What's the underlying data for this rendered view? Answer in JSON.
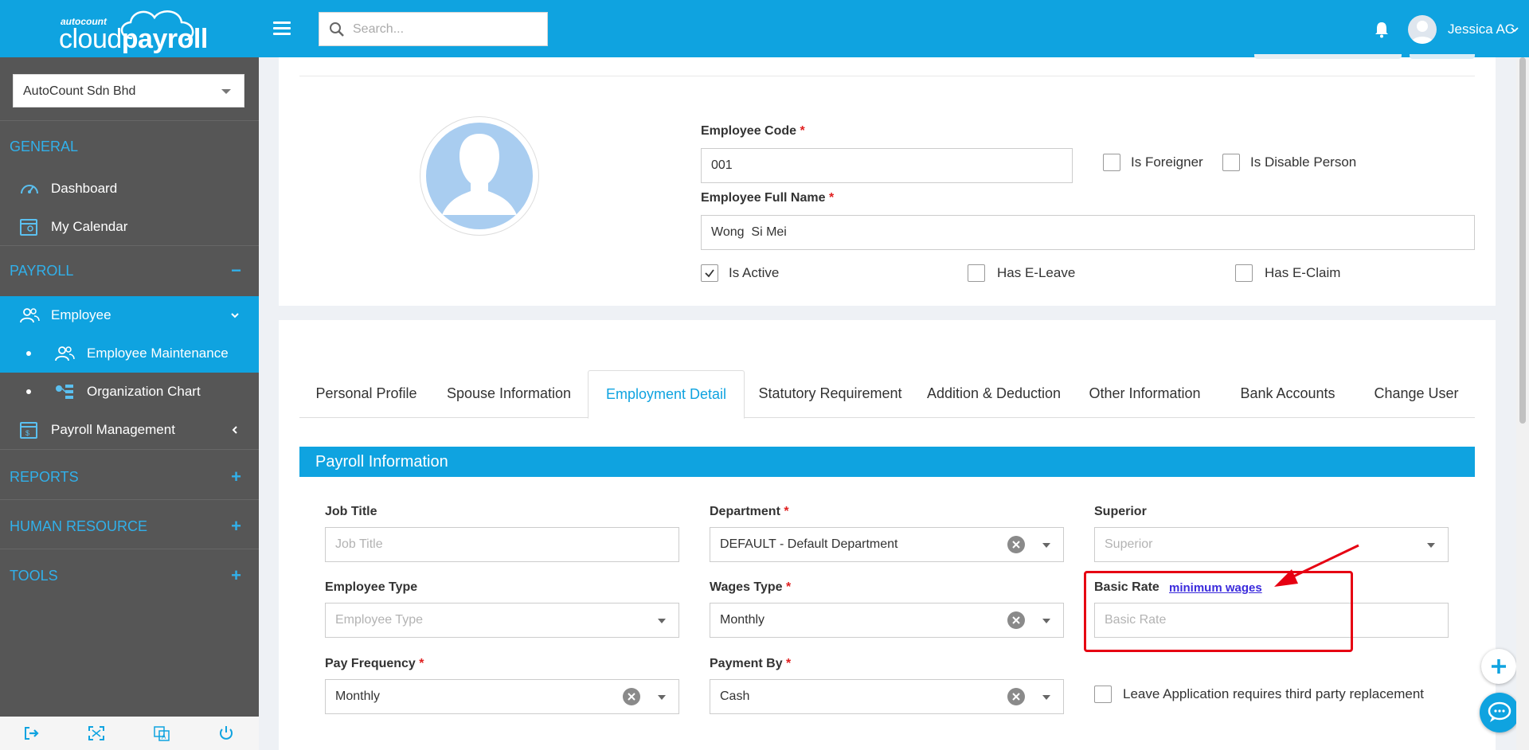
{
  "header": {
    "logo_small": "autocount",
    "logo_cloud": "cloud",
    "logo_payroll": "payroll",
    "search_placeholder": "Search...",
    "user_name": "Jessica AC"
  },
  "sidebar": {
    "company": "AutoCount Sdn Bhd",
    "general": {
      "title": "GENERAL",
      "items": [
        "Dashboard",
        "My Calendar"
      ]
    },
    "payroll": {
      "title": "PAYROLL",
      "toggle": "−",
      "employee": "Employee",
      "sub_items": [
        "Employee Maintenance",
        "Organization Chart"
      ],
      "payroll_management": "Payroll Management"
    },
    "reports": {
      "title": "REPORTS",
      "toggle": "+"
    },
    "human_resource": {
      "title": "HUMAN RESOURCE",
      "toggle": "+"
    },
    "tools": {
      "title": "TOOLS",
      "toggle": "+"
    }
  },
  "employee": {
    "code_label": "Employee Code",
    "code_value": "001",
    "full_name_label": "Employee Full Name",
    "full_name_value": "Wong  Si Mei",
    "required_mark": "*",
    "is_foreigner": "Is Foreigner",
    "is_disable": "Is Disable Person",
    "is_active": "Is Active",
    "has_eleave": "Has E-Leave",
    "has_eclaim": "Has E-Claim",
    "is_active_checked": true
  },
  "tabs": [
    "Personal Profile",
    "Spouse Information",
    "Employment Detail",
    "Statutory Requirement",
    "Addition & Deduction",
    "Other Information",
    "Bank Accounts",
    "Change User"
  ],
  "active_tab": "Employment Detail",
  "payroll_info": {
    "title": "Payroll Information",
    "job_title_label": "Job Title",
    "job_title_placeholder": "Job Title",
    "department_label": "Department",
    "department_value": "DEFAULT - Default Department",
    "superior_label": "Superior",
    "superior_placeholder": "Superior",
    "employee_type_label": "Employee Type",
    "employee_type_placeholder": "Employee Type",
    "wages_type_label": "Wages Type",
    "wages_type_value": "Monthly",
    "basic_rate_label": "Basic Rate",
    "minimum_wages_link": "minimum wages",
    "basic_rate_placeholder": "Basic Rate",
    "pay_frequency_label": "Pay Frequency",
    "pay_frequency_value": "Monthly",
    "payment_by_label": "Payment By",
    "payment_by_value": "Cash",
    "leave_replacement_label": "Leave Application requires third party replacement"
  },
  "colors": {
    "primary": "#0fa3e0",
    "sidebar": "#565656",
    "highlight": "#e60012",
    "link": "#3b2bdc"
  }
}
